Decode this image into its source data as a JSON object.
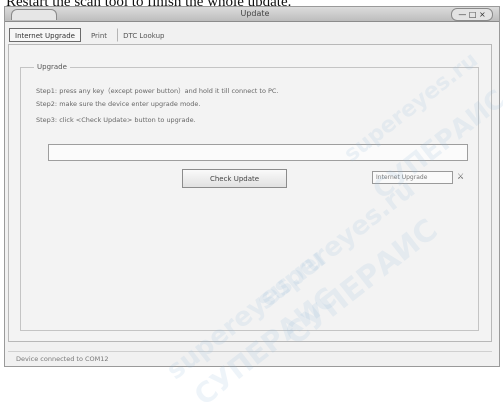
{
  "caption": "Restart the scan tool to finish the whole update.",
  "window": {
    "title": "Update",
    "controls_label": "— □ ×"
  },
  "tabs": [
    {
      "label": "Internet Upgrade",
      "active": true
    },
    {
      "label": "Print",
      "active": false
    },
    {
      "label": "DTC Lookup",
      "active": false
    }
  ],
  "upgrade": {
    "group_label": "Upgrade",
    "steps": [
      "Step1: press any key（except power button）and hold it till connect to PC.",
      "Step2: make sure the device enter upgrade mode.",
      "Step3: click <Check Update> button to upgrade."
    ],
    "progress": 0,
    "check_update_label": "Check Update",
    "path_value": "Internet Upgrade",
    "browse_icon": "⚔"
  },
  "status": {
    "text": "Device connected to COM12"
  },
  "watermark": {
    "text1": "supereyes.ru",
    "text2": "СУПЕРАИС",
    "color": "#96b9d7"
  }
}
